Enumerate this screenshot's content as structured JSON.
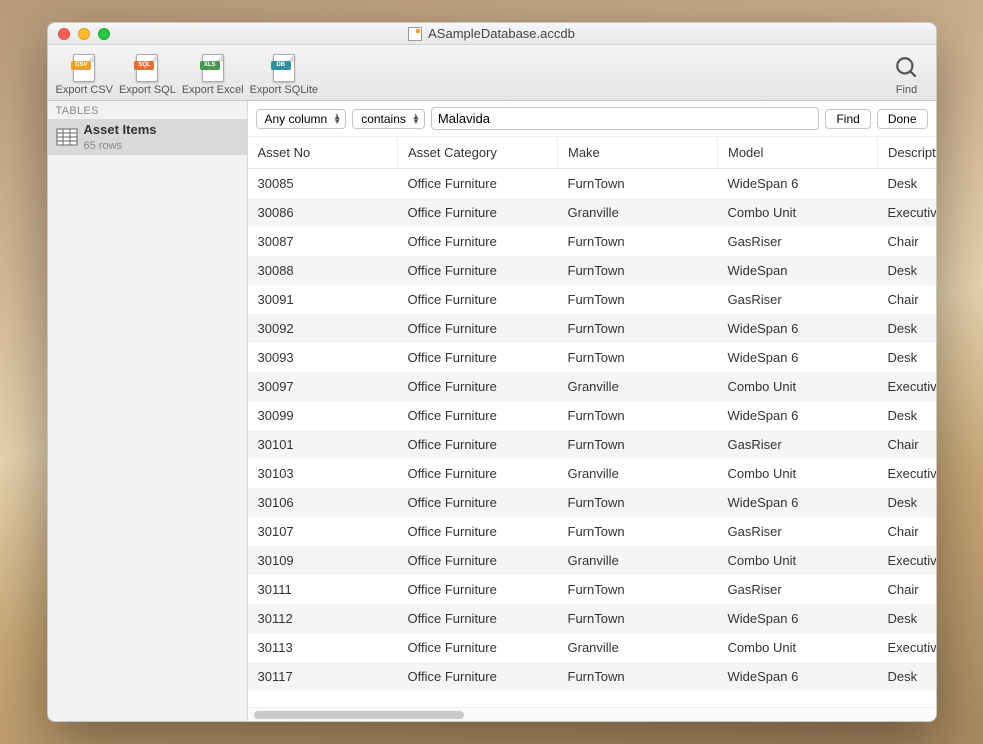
{
  "window": {
    "title": "ASampleDatabase.accdb"
  },
  "toolbar": {
    "items": [
      {
        "label": "Export CSV",
        "tag": "CSV",
        "tagClass": "tag-csv"
      },
      {
        "label": "Export SQL",
        "tag": "SQL",
        "tagClass": "tag-sql"
      },
      {
        "label": "Export Excel",
        "tag": "XLS",
        "tagClass": "tag-xls"
      },
      {
        "label": "Export SQLite",
        "tag": "DB",
        "tagClass": "tag-db"
      }
    ],
    "find_label": "Find"
  },
  "sidebar": {
    "header": "TABLES",
    "items": [
      {
        "name": "Asset Items",
        "rows": "65 rows"
      }
    ]
  },
  "filter": {
    "column_select": "Any column",
    "match_select": "contains",
    "search_value": "Malavida",
    "find_btn": "Find",
    "done_btn": "Done"
  },
  "grid": {
    "headers": [
      "Asset No",
      "Asset Category",
      "Make",
      "Model",
      "Description"
    ],
    "rows": [
      [
        "30085",
        "Office Furniture",
        "FurnTown",
        "WideSpan 6",
        "Desk"
      ],
      [
        "30086",
        "Office Furniture",
        "Granville",
        "Combo Unit",
        "Executive"
      ],
      [
        "30087",
        "Office Furniture",
        "FurnTown",
        "GasRiser",
        "Chair"
      ],
      [
        "30088",
        "Office Furniture",
        "FurnTown",
        "WideSpan",
        "Desk"
      ],
      [
        "30091",
        "Office Furniture",
        "FurnTown",
        "GasRiser",
        "Chair"
      ],
      [
        "30092",
        "Office Furniture",
        "FurnTown",
        "WideSpan 6",
        "Desk"
      ],
      [
        "30093",
        "Office Furniture",
        "FurnTown",
        "WideSpan 6",
        "Desk"
      ],
      [
        "30097",
        "Office Furniture",
        "Granville",
        "Combo Unit",
        "Executive"
      ],
      [
        "30099",
        "Office Furniture",
        "FurnTown",
        "WideSpan 6",
        "Desk"
      ],
      [
        "30101",
        "Office Furniture",
        "FurnTown",
        "GasRiser",
        "Chair"
      ],
      [
        "30103",
        "Office Furniture",
        "Granville",
        "Combo Unit",
        "Executive"
      ],
      [
        "30106",
        "Office Furniture",
        "FurnTown",
        "WideSpan 6",
        "Desk"
      ],
      [
        "30107",
        "Office Furniture",
        "FurnTown",
        "GasRiser",
        "Chair"
      ],
      [
        "30109",
        "Office Furniture",
        "Granville",
        "Combo Unit",
        "Executive"
      ],
      [
        "30111",
        "Office Furniture",
        "FurnTown",
        "GasRiser",
        "Chair"
      ],
      [
        "30112",
        "Office Furniture",
        "FurnTown",
        "WideSpan 6",
        "Desk"
      ],
      [
        "30113",
        "Office Furniture",
        "Granville",
        "Combo Unit",
        "Executive"
      ],
      [
        "30117",
        "Office Furniture",
        "FurnTown",
        "WideSpan 6",
        "Desk"
      ]
    ]
  }
}
